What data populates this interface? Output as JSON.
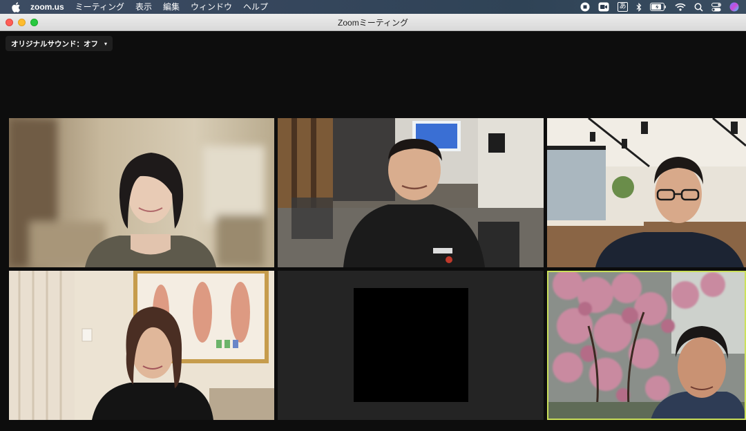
{
  "menubar": {
    "app_name": "zoom.us",
    "menus": [
      "ミーティング",
      "表示",
      "編集",
      "ウィンドウ",
      "ヘルプ"
    ],
    "input_method": "あ",
    "icons": [
      "apple-icon",
      "record-icon",
      "camera-icon",
      "bluetooth-icon",
      "battery-icon",
      "wifi-icon",
      "search-icon",
      "control-center-icon",
      "siri-icon"
    ]
  },
  "window": {
    "title": "Zoomミーティング"
  },
  "toolbar": {
    "original_sound_label": "オリジナルサウンド：オフ",
    "original_sound_caret": "▾"
  },
  "participants": [
    {
      "id": "p1",
      "scene": "blurred-room",
      "active": false
    },
    {
      "id": "p2",
      "scene": "event-space-presenter",
      "active": false
    },
    {
      "id": "p3",
      "scene": "cafe-office",
      "active": false
    },
    {
      "id": "p4",
      "scene": "acupuncture-chart-room",
      "active": false
    },
    {
      "id": "p5",
      "scene": "camera-off",
      "active": false
    },
    {
      "id": "p6",
      "scene": "cherry-blossom-outdoor",
      "active": true
    }
  ],
  "colors": {
    "active_speaker_border": "#cbe05a",
    "meeting_background": "#0d0d0d"
  }
}
